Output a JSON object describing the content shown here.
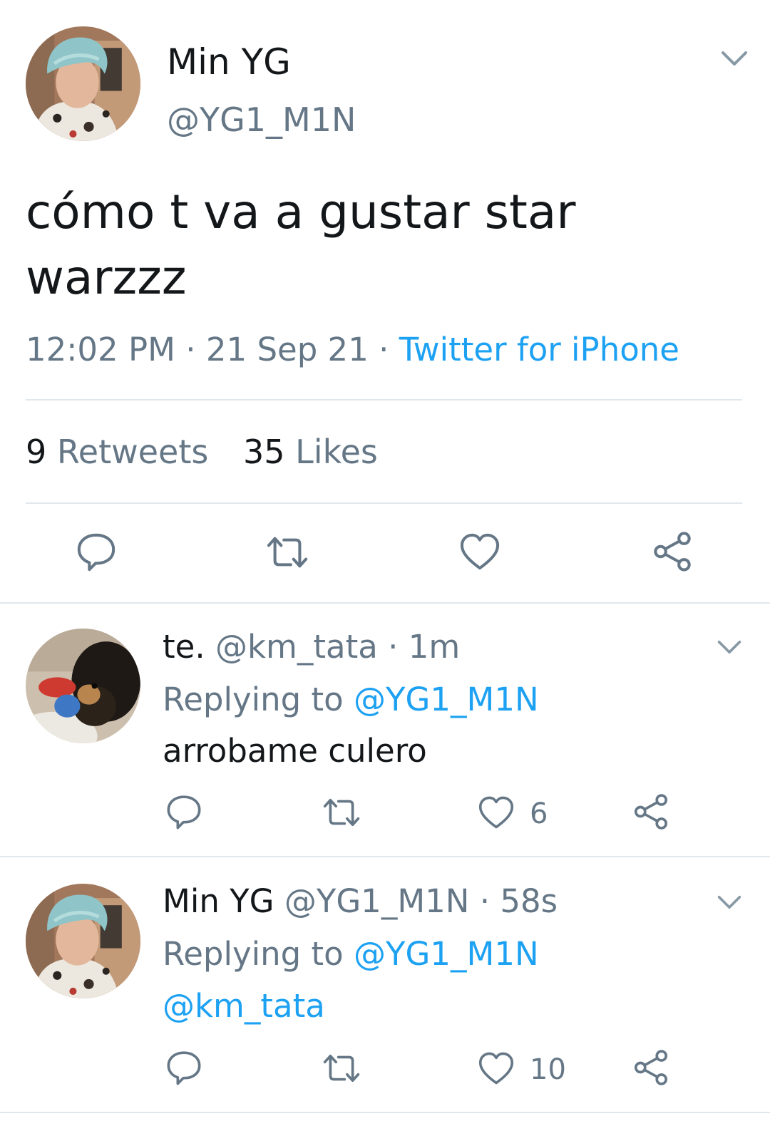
{
  "main_tweet": {
    "name": "Min YG",
    "handle": "@YG1_M1N",
    "text_line1": "cómo t va a gustar star",
    "text_line2": "warzzz",
    "time": "12:02 PM",
    "sep1": " · ",
    "date": "21 Sep 21",
    "sep2": " · ",
    "source": "Twitter for iPhone",
    "retweets_count": "9",
    "retweets_label": "Retweets",
    "likes_count": "35",
    "likes_label": "Likes"
  },
  "replies": [
    {
      "name": "te.",
      "handle": "@km_tata",
      "sep": " · ",
      "time": "1m",
      "replying_label": "Replying to",
      "replying_handle": "@YG1_M1N",
      "text": "arrobame culero",
      "likes": "6"
    },
    {
      "name": "Min YG",
      "handle": "@YG1_M1N",
      "sep": " · ",
      "time": "58s",
      "replying_label": "Replying to",
      "replying_handle": "@YG1_M1N",
      "text": "@km_tata",
      "likes": "10"
    }
  ],
  "colors": {
    "link": "#1da1f2",
    "muted": "#657786",
    "text": "#14171a",
    "divider": "#e1e8ed"
  },
  "icons": [
    "chevron-down-icon",
    "reply-icon",
    "retweet-icon",
    "like-icon",
    "share-icon"
  ]
}
